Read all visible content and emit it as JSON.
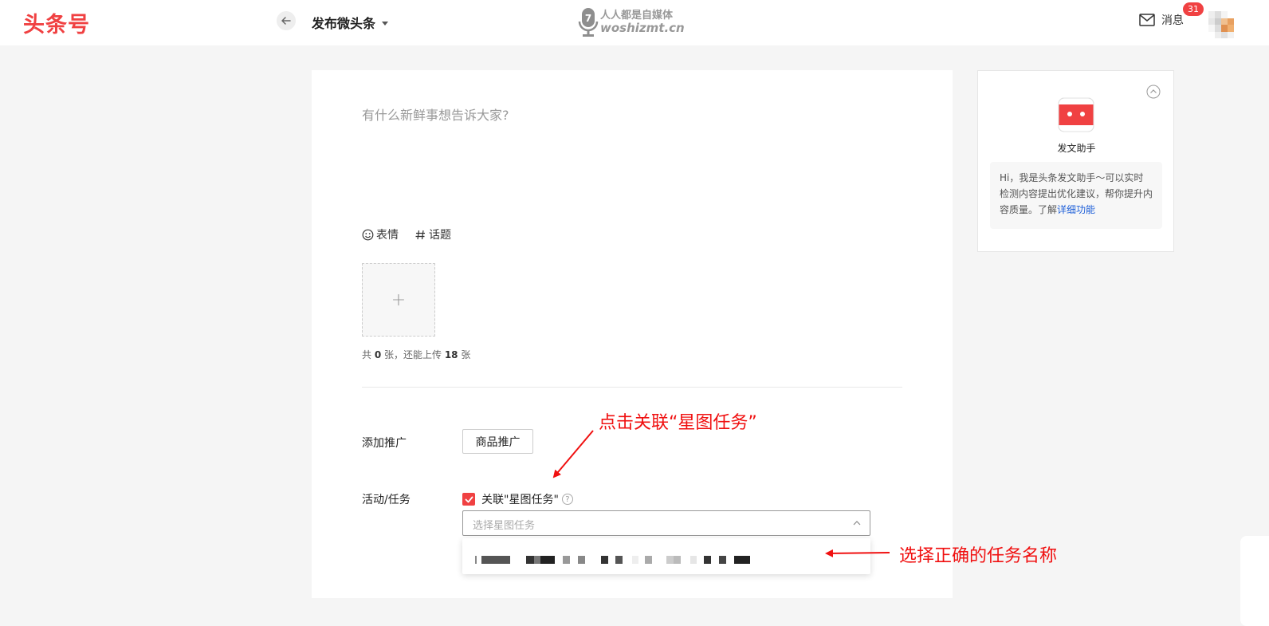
{
  "header": {
    "logo": "头条号",
    "title": "发布微头条",
    "watermark_cn": "人人都是自媒体",
    "watermark_en": "woshizmt.cn",
    "messages_label": "消息",
    "messages_count": "31"
  },
  "editor": {
    "placeholder": "有什么新鲜事想告诉大家?",
    "toolbar": {
      "emoji": "表情",
      "topic": "话题"
    },
    "upload_plus": "+",
    "upload_hint_prefix": "共 ",
    "upload_count": "0",
    "upload_hint_mid": " 张，还能上传 ",
    "upload_remaining": "18",
    "upload_hint_suffix": " 张"
  },
  "promotion": {
    "label": "添加推广",
    "button": "商品推广"
  },
  "task": {
    "label": "活动/任务",
    "checkbox_label": "关联\"星图任务\"",
    "checked": true,
    "help": "?",
    "select_placeholder": "选择星图任务"
  },
  "assistant": {
    "title": "发文助手",
    "tip_text": "Hi，我是头条发文助手～可以实时检测内容提出优化建议，帮你提升内容质量。了解",
    "tip_link": "详细功能"
  },
  "annotations": {
    "top": "点击关联“星图任务”",
    "right": "选择正确的任务名称"
  },
  "colors": {
    "brand": "#f04142",
    "annotation": "#f01010",
    "link": "#1e5fd8"
  }
}
